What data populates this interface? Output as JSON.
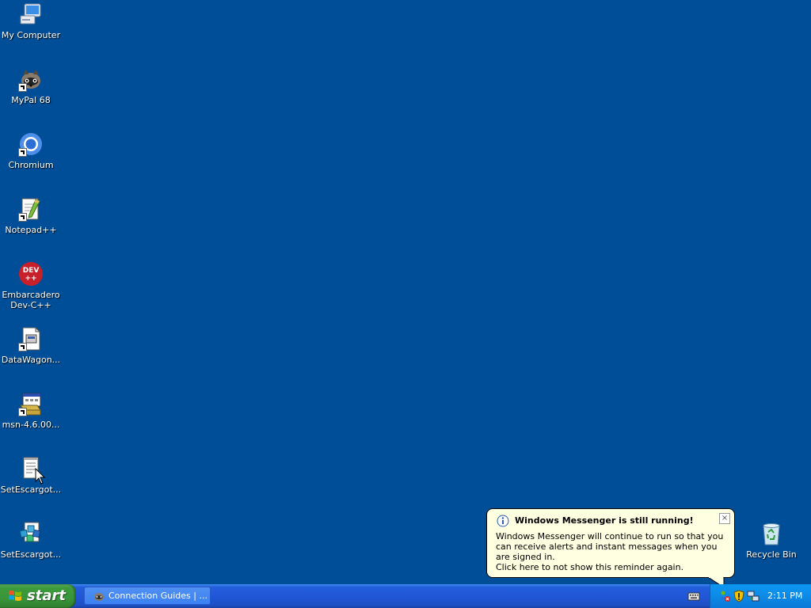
{
  "desktop": {
    "background": "#004E98",
    "icons": [
      {
        "label": "My Computer",
        "icon": "my-computer-icon"
      },
      {
        "label": "MyPal 68",
        "icon": "mypal-raccoon-icon"
      },
      {
        "label": "Chromium",
        "icon": "chromium-icon"
      },
      {
        "label": "Notepad++",
        "icon": "notepad-plus-plus-icon"
      },
      {
        "label": "Embarcadero\nDev-C++",
        "icon": "dev-cpp-icon"
      },
      {
        "label": "DataWagon...",
        "icon": "datawagon-document-icon"
      },
      {
        "label": "msn-4.6.00...",
        "icon": "msn-installer-icon"
      },
      {
        "label": "SetEscargot...",
        "icon": "setescargot-text-icon"
      },
      {
        "label": "SetEscargot...",
        "icon": "setescargot-registry-icon"
      },
      {
        "label": "Recycle Bin",
        "icon": "recycle-bin-icon"
      }
    ]
  },
  "taskbar": {
    "start_label": "start",
    "task_button_label": "Connection Guides | ...",
    "clock": "2:11 PM",
    "colors": {
      "taskbar": "#245EDB",
      "start": "#3C9A3C",
      "tray": "#0D8DEA"
    }
  },
  "balloon": {
    "title": "Windows Messenger is still running!",
    "body": "Windows Messenger will continue to run so that you can receive alerts and instant messages when you are signed in.",
    "link": "Click here to not show this reminder again.",
    "close_glyph": "×",
    "background": "#FFFFE1"
  }
}
